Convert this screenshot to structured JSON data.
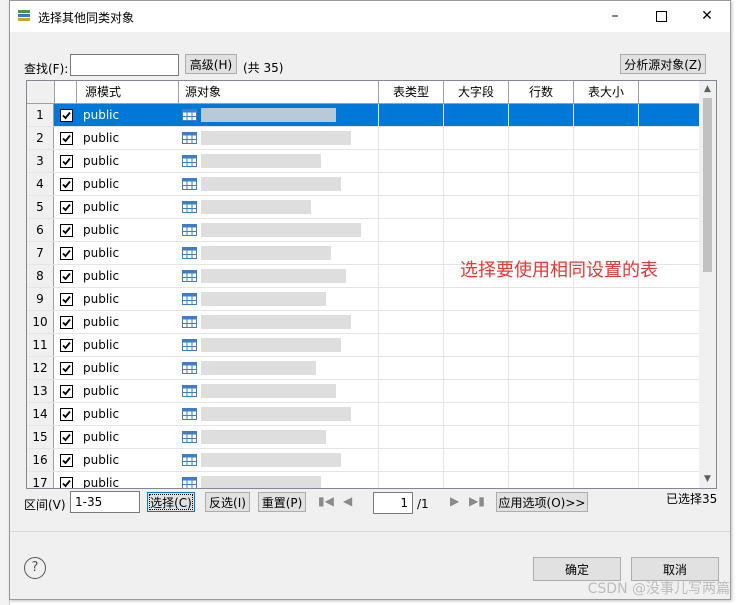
{
  "window": {
    "title": "选择其他同类对象"
  },
  "search": {
    "label": "查找(F):",
    "value": "",
    "advanced_label": "高级(H)",
    "count": "(共 35)",
    "analyze_label": "分析源对象(Z)"
  },
  "table": {
    "columns": [
      "源模式",
      "源对象",
      "表类型",
      "大字段",
      "行数",
      "表大小"
    ],
    "rows": [
      {
        "n": "1",
        "schema": "public"
      },
      {
        "n": "2",
        "schema": "public"
      },
      {
        "n": "3",
        "schema": "public"
      },
      {
        "n": "4",
        "schema": "public"
      },
      {
        "n": "5",
        "schema": "public"
      },
      {
        "n": "6",
        "schema": "public"
      },
      {
        "n": "7",
        "schema": "public"
      },
      {
        "n": "8",
        "schema": "public"
      },
      {
        "n": "9",
        "schema": "public"
      },
      {
        "n": "10",
        "schema": "public"
      },
      {
        "n": "11",
        "schema": "public"
      },
      {
        "n": "12",
        "schema": "public"
      },
      {
        "n": "13",
        "schema": "public"
      },
      {
        "n": "14",
        "schema": "public"
      },
      {
        "n": "15",
        "schema": "public"
      },
      {
        "n": "16",
        "schema": "public"
      },
      {
        "n": "17",
        "schema": "public"
      }
    ]
  },
  "annotation": "选择要使用相同设置的表",
  "bottom": {
    "range_label": "区间(V)",
    "range_value": "1-35",
    "select_label": "选择(C)",
    "invert_label": "反选(I)",
    "reset_label": "重置(P)",
    "page_value": "1",
    "page_total": "/1",
    "apply_label": "应用选项(O)>>",
    "selected_count": "已选择35"
  },
  "footer": {
    "ok_label": "确定",
    "cancel_label": "取消"
  },
  "watermark": "CSDN @没事儿写两篇",
  "colors": {
    "selection": "#0078d7",
    "annotation": "#e53935"
  }
}
